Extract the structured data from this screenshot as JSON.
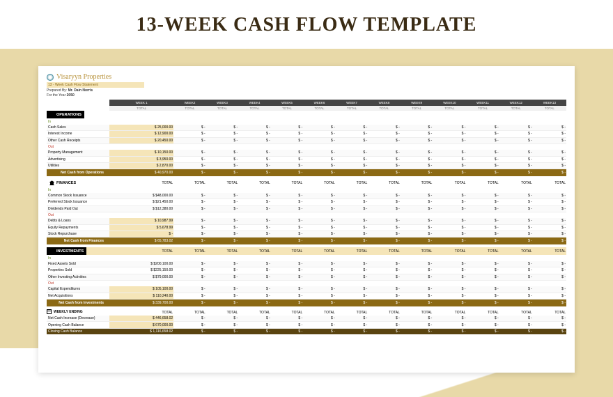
{
  "title": "13-WEEK CASH FLOW TEMPLATE",
  "company": "Visaryyn Properties",
  "subtitle": "13 - Week Cash Flow Statement",
  "prepared_label": "Prepared By:",
  "prepared_by": "Mr. Dain Norris",
  "year_label": "For the Year",
  "year": "2050",
  "weeks": [
    "WEEK 1",
    "WEEK2",
    "WEEK3",
    "WEEK4",
    "WEEK5",
    "WEEK6",
    "WEEK7",
    "WEEK8",
    "WEEK9",
    "WEEK10",
    "WEEK11",
    "WEEK12",
    "WEEK13"
  ],
  "total": "TOTAL",
  "sections": {
    "ops": {
      "title": "OPERATIONS",
      "in": "In",
      "out": "Out",
      "in_rows": [
        {
          "label": "Cash Sales",
          "val": "25,000.00"
        },
        {
          "label": "Interest Income",
          "val": "12,900.00"
        },
        {
          "label": "Other Cash Receipts",
          "val": "20,450.00"
        }
      ],
      "out_rows": [
        {
          "label": "Property Management",
          "val": "10,150.00"
        },
        {
          "label": "Advertising",
          "val": "3,950.00"
        },
        {
          "label": "Utilities",
          "val": "2,870.00"
        }
      ],
      "net_label": "Net Cash from Operations",
      "net": "40,970.00"
    },
    "fin": {
      "title": "FINANCES",
      "in": "In",
      "out": "Out",
      "in_rows": [
        {
          "label": "Common Stock Issuance",
          "val": "$48,000.00"
        },
        {
          "label": "Preferred Stock Issuance",
          "val": "$21,450.00"
        },
        {
          "label": "Dividends Paid Out",
          "val": "$12,380.00"
        }
      ],
      "out_rows": [
        {
          "label": "Debts & Loans",
          "val": "10,987.99"
        },
        {
          "label": "Equity Repayments",
          "val": "5,678.99"
        },
        {
          "label": "Stock Repurchase",
          "val": "-"
        }
      ],
      "net_label": "Net Cash from Finances",
      "net": "65,783.02"
    },
    "inv": {
      "title": "INVESTMENTS",
      "in": "In",
      "out": "Out",
      "in_rows": [
        {
          "label": "Fixed Assets Sold",
          "val": "$200,100.00"
        },
        {
          "label": "Properties Sold",
          "val": "$225,150.00"
        },
        {
          "label": "Other Investing Activities",
          "val": "$79,000.00"
        }
      ],
      "out_rows": [
        {
          "label": "Capital Expenditures",
          "val": "105,100.00"
        },
        {
          "label": "Net Acquisitions",
          "val": "110,240.00"
        }
      ],
      "net_label": "Net Cash from Investments",
      "net": "339,700.00"
    },
    "wk": {
      "title": "WEEKLY ENDING",
      "rows": [
        {
          "label": "Net Cash Increase (Decrease)",
          "val": "446,658.02"
        },
        {
          "label": "Opening Cash Balance",
          "val": "670,000.00"
        }
      ],
      "close_label": "Closing Cash Balance",
      "close": "1,116,658.02"
    }
  }
}
